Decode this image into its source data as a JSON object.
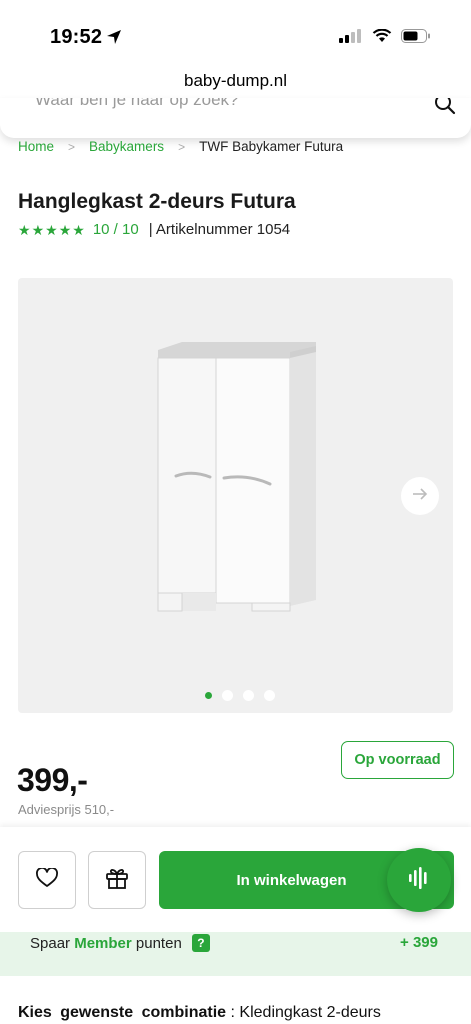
{
  "status_bar": {
    "time": "19:52"
  },
  "browser": {
    "url": "baby-dump.nl"
  },
  "search": {
    "placeholder": "Waar ben je naar op zoek?"
  },
  "breadcrumb": {
    "items": [
      {
        "label": "Home"
      },
      {
        "label": "Babykamers"
      },
      {
        "label": "TWF Babykamer Futura"
      }
    ],
    "separator": ">"
  },
  "product": {
    "title": "Hanglegkast 2-deurs Futura",
    "rating": {
      "stars": 5,
      "text": "10 / 10"
    },
    "article_number": "| Artikelnummer 1054",
    "gallery": {
      "total_images": 4,
      "active_index": 0
    },
    "price": "399,-",
    "advice_price": "Adviesprijs 510,-",
    "stock": "Op voorraad"
  },
  "actions": {
    "add_to_cart": "In winkelwagen"
  },
  "member": {
    "prefix": "Spaar",
    "highlight": "Member",
    "suffix": "punten",
    "help": "?",
    "points": "+ 399"
  },
  "combination": {
    "label": "Kies gewenste combinatie",
    "separator": ":",
    "value": "Kledingkast 2-deurs"
  },
  "colors": {
    "accent": "#2aa63a",
    "member_bg": "#e7f5e9",
    "gallery_bg": "#f0f0f0"
  },
  "icons": [
    "location-arrow-icon",
    "signal-icon",
    "wifi-icon",
    "battery-icon",
    "search-icon",
    "chevron-right-icon",
    "arrow-right-icon",
    "heart-icon",
    "gift-icon",
    "voice-icon",
    "star-icon"
  ]
}
